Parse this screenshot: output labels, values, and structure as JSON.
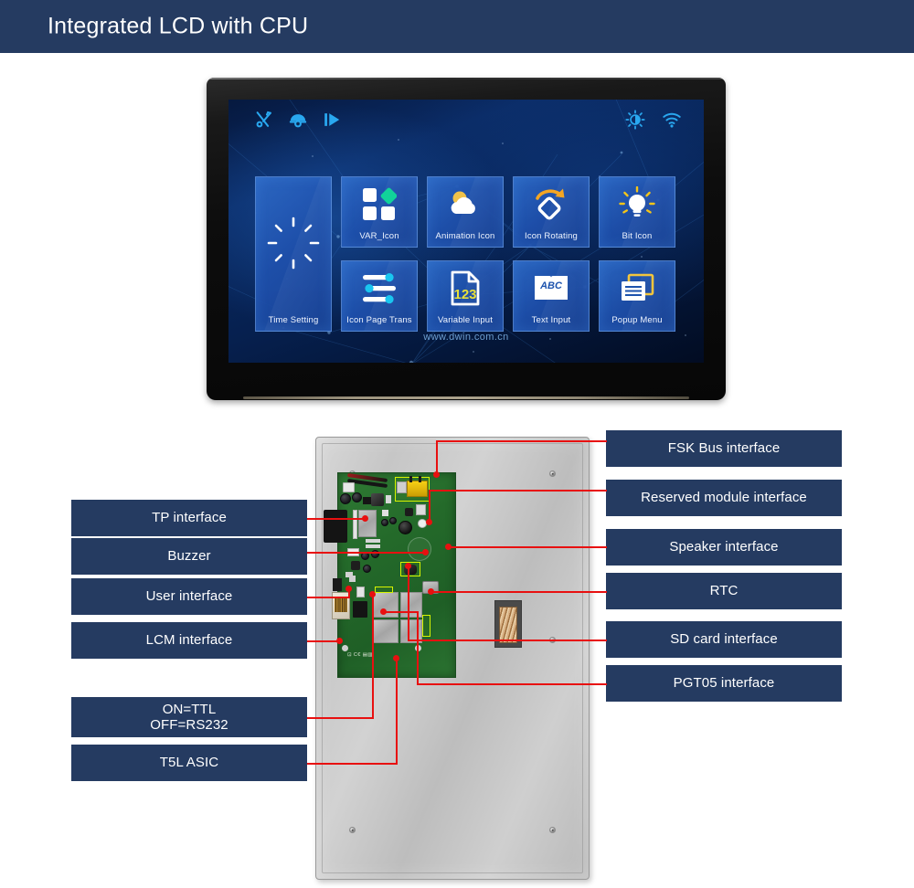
{
  "header": {
    "title": "Integrated LCD with CPU"
  },
  "screen": {
    "watermark": "www.dwin.com.cn",
    "status_icons_left": [
      "tools-icon",
      "camera-icon",
      "play-icon"
    ],
    "status_icons_right": [
      "brightness-icon",
      "wifi-icon"
    ],
    "tiles": [
      {
        "label": "Time Setting",
        "icon": "clock-dial-icon"
      },
      {
        "label": "VAR_Icon",
        "icon": "four-squares-icon"
      },
      {
        "label": "Animation Icon",
        "icon": "cloud-sun-icon"
      },
      {
        "label": "Icon Rotating",
        "icon": "rotate-diamond-icon"
      },
      {
        "label": "Bit Icon",
        "icon": "lightbulb-icon"
      },
      {
        "label": "Icon Page Trans",
        "icon": "sliders-icon"
      },
      {
        "label": "Variable Input",
        "icon": "numeric-123-icon"
      },
      {
        "label": "Text Input",
        "icon": "abc-book-icon"
      },
      {
        "label": "Popup Menu",
        "icon": "windows-stack-icon"
      }
    ]
  },
  "diagram": {
    "labels_left": [
      {
        "text": "TP interface"
      },
      {
        "text": "Buzzer"
      },
      {
        "text": "User interface"
      },
      {
        "text": "LCM interface"
      },
      {
        "text": "ON=TTL\nOFF=RS232"
      },
      {
        "text": "T5L ASIC"
      }
    ],
    "labels_right": [
      {
        "text": "FSK Bus interface"
      },
      {
        "text": "Reserved module interface"
      },
      {
        "text": "Speaker interface"
      },
      {
        "text": "RTC"
      },
      {
        "text": "SD card interface"
      },
      {
        "text": "PGT05 interface"
      }
    ]
  },
  "colors": {
    "header_bg": "#253B61",
    "label_bg": "#253B61",
    "label_text": "#ffffff",
    "lead_line": "#e81010",
    "highlight_box": "#d8f400",
    "screen_blue": "#0a2a63",
    "tile_blue": "#1e50ac"
  }
}
